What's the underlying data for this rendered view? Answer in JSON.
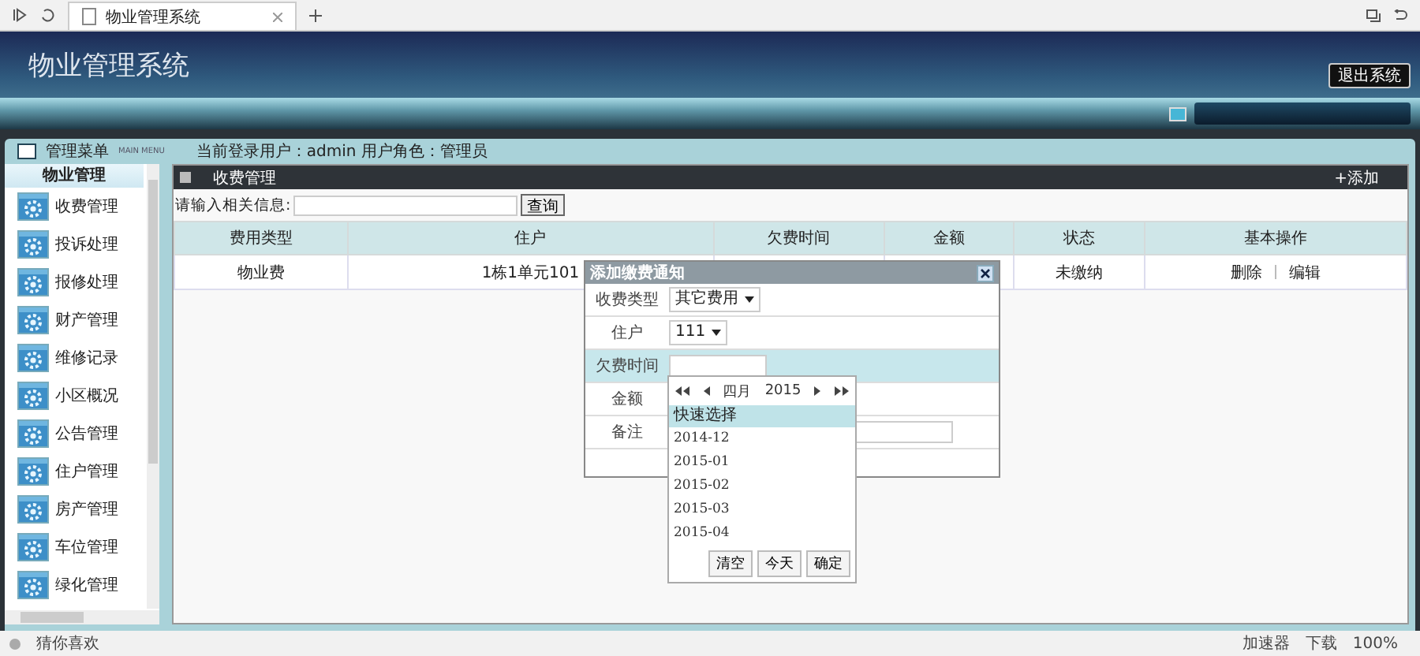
{
  "browser": {
    "tab_title": "物业管理系统",
    "status_text": "猜你喜欢",
    "status_items": [
      "加速器",
      "下载",
      "100%"
    ]
  },
  "header": {
    "title": "物业管理系统",
    "logout": "退出系统"
  },
  "info": {
    "menu_label": "管理菜单",
    "menu_sub": "MAIN MENU",
    "user_text": "当前登录用户：admin 用户角色：管理员"
  },
  "sidebar": {
    "heading": "物业管理",
    "items": [
      "收费管理",
      "投诉处理",
      "报修处理",
      "财产管理",
      "维修记录",
      "小区概况",
      "公告管理",
      "住户管理",
      "房产管理",
      "车位管理",
      "绿化管理"
    ]
  },
  "panel": {
    "title": "收费管理",
    "add": "+添加",
    "search_label": "请输入相关信息:",
    "search_button": "查询",
    "columns": [
      "费用类型",
      "住户",
      "欠费时间",
      "金额",
      "状态",
      "基本操作"
    ],
    "rows": [
      {
        "fee_type": "物业费",
        "resident": "1栋1单元101",
        "status": "未缴纳",
        "actions": [
          "删除",
          "编辑"
        ]
      }
    ]
  },
  "dialog": {
    "title": "添加缴费通知",
    "fields": [
      {
        "label": "收费类型",
        "kind": "select",
        "value": "其它费用",
        "focused": false
      },
      {
        "label": "住户",
        "kind": "select",
        "value": "111",
        "focused": false
      },
      {
        "label": "欠费时间",
        "kind": "input",
        "focused": true
      },
      {
        "label": "金额",
        "kind": "input",
        "focused": false
      },
      {
        "label": "备注",
        "kind": "wide",
        "focused": false
      }
    ]
  },
  "datepicker": {
    "month": "四月",
    "year": "2015",
    "quick_label": "快速选择",
    "options": [
      "2014-12",
      "2015-01",
      "2015-02",
      "2015-03",
      "2015-04"
    ],
    "buttons": [
      "清空",
      "今天",
      "确定"
    ]
  }
}
